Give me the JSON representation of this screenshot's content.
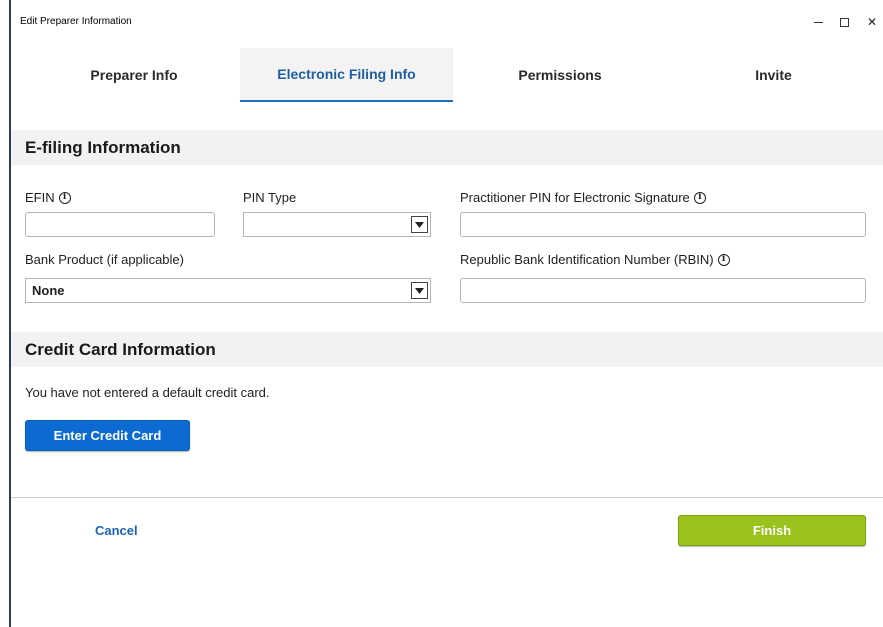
{
  "window": {
    "title": "Edit Preparer Information",
    "minimize_glyph": "–",
    "close_glyph": "✕"
  },
  "tabs": [
    {
      "label": "Preparer Info",
      "active": false
    },
    {
      "label": "Electronic Filing Info",
      "active": true
    },
    {
      "label": "Permissions",
      "active": false
    },
    {
      "label": "Invite",
      "active": false
    }
  ],
  "efiling": {
    "header": "E-filing Information",
    "efin": {
      "label": "EFIN",
      "value": ""
    },
    "pin_type": {
      "label": "PIN Type",
      "selected": ""
    },
    "practitioner_pin": {
      "label": "Practitioner PIN for Electronic Signature",
      "value": ""
    },
    "bank_product": {
      "label": "Bank Product (if applicable)",
      "selected": "None"
    },
    "rbin": {
      "label": "Republic Bank Identification Number (RBIN)",
      "value": ""
    }
  },
  "credit_card": {
    "header": "Credit Card Information",
    "message": "You have not entered a default credit card.",
    "button_label": "Enter Credit Card"
  },
  "footer": {
    "cancel_label": "Cancel",
    "finish_label": "Finish"
  },
  "icons": {
    "info_glyph": "i"
  },
  "colors": {
    "primary_blue": "#0b6bd3",
    "active_tab_text": "#1f5f9e",
    "finish_green": "#99c31c",
    "section_bg": "#f2f2f2"
  }
}
